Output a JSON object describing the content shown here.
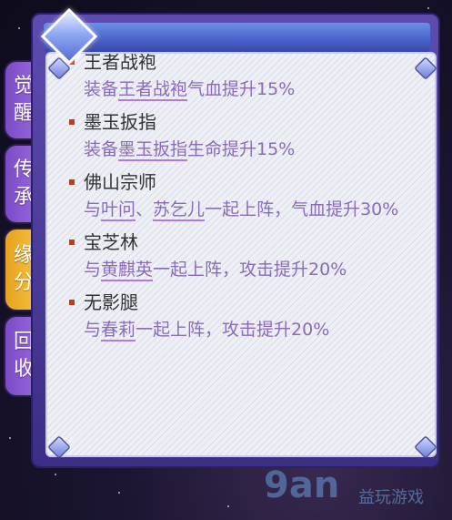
{
  "tabs": [
    {
      "label": "觉醒",
      "active": false
    },
    {
      "label": "传承",
      "active": false
    },
    {
      "label": "缘分",
      "active": true
    },
    {
      "label": "回收",
      "active": false
    }
  ],
  "items": [
    {
      "name": "王者战袍",
      "desc_pre": "装备",
      "desc_hl": "王者战袍",
      "desc_post": "气血提升15%"
    },
    {
      "name": "墨玉扳指",
      "desc_pre": "装备",
      "desc_hl": "墨玉扳指",
      "desc_post": "生命提升15%"
    },
    {
      "name": "佛山宗师",
      "desc_pre": "与",
      "desc_hl": "叶问",
      "desc_mid": "、",
      "desc_hl2": "苏乞儿",
      "desc_post": "一起上阵，气血提升30%"
    },
    {
      "name": "宝芝林",
      "desc_pre": "与",
      "desc_hl": "黄麒英",
      "desc_post": "一起上阵，攻击提升20%"
    },
    {
      "name": "无影腿",
      "desc_pre": "与",
      "desc_hl": "春莉",
      "desc_post": "一起上阵，攻击提升20%"
    }
  ],
  "watermark": {
    "logo": "9an",
    "text": "益玩游戏"
  },
  "colors": {
    "accent_purple": "#8a6bb8",
    "underline": "#b477e8",
    "bullet": "#b8401e",
    "tab_active": "#f4c642"
  }
}
